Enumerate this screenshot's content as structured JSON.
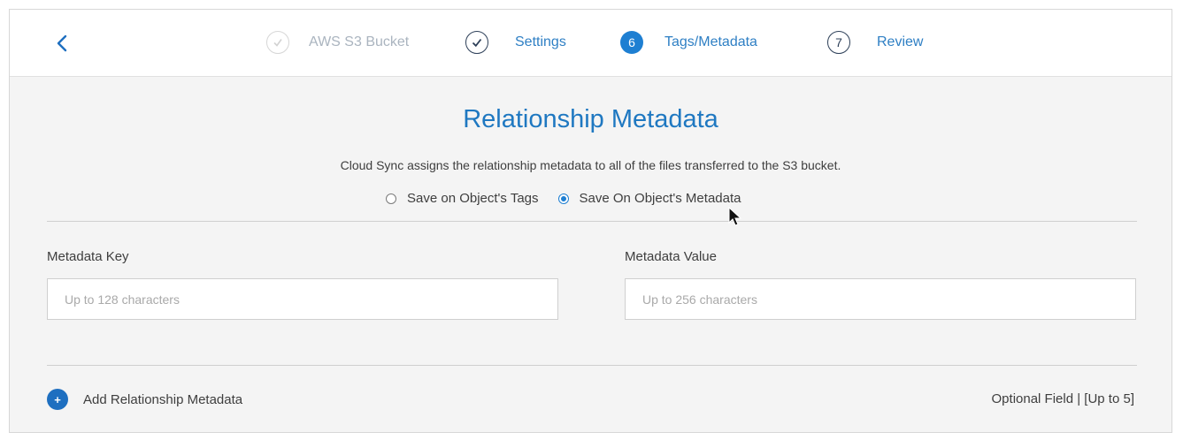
{
  "header": {
    "back_icon": "chevron-left-icon",
    "steps": [
      {
        "number": "",
        "icon": "check-icon",
        "label": "AWS S3 Bucket",
        "state": "done-faded"
      },
      {
        "number": "",
        "icon": "check-icon",
        "label": "Settings",
        "state": "done"
      },
      {
        "number": "6",
        "label": "Tags/Metadata",
        "state": "active"
      },
      {
        "number": "7",
        "label": "Review",
        "state": "upcoming"
      }
    ]
  },
  "main": {
    "title": "Relationship Metadata",
    "description": "Cloud Sync assigns the relationship metadata to all of the files transferred to the S3 bucket.",
    "radio_options": [
      {
        "label": "Save on Object's Tags",
        "checked": false
      },
      {
        "label": "Save On Object's Metadata",
        "checked": true
      }
    ],
    "fields": {
      "key": {
        "label": "Metadata Key",
        "value": "",
        "placeholder": "Up to 128 characters"
      },
      "value": {
        "label": "Metadata Value",
        "value": "",
        "placeholder": "Up to 256 characters"
      }
    },
    "add_button": {
      "icon": "plus-icon",
      "icon_glyph": "+",
      "label": "Add Relationship Metadata"
    },
    "optional_text": "Optional Field | [Up to 5]"
  },
  "colors": {
    "accent": "#1e7fd2",
    "title": "#1f78c1",
    "link": "#2e7fc4",
    "background": "#f4f4f4"
  }
}
